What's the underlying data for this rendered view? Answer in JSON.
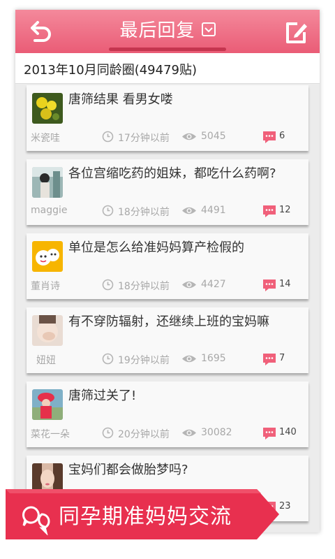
{
  "header": {
    "title": "最后回复",
    "back_icon": "back-arrow-icon",
    "dropdown_icon": "chevron-down-icon",
    "edit_icon": "compose-icon"
  },
  "subheader": {
    "text": "2013年10月同龄圈(49479贴)"
  },
  "posts": [
    {
      "title": "唐筛结果 看男女喽",
      "author": "米瓷哇",
      "time": "17分钟以前",
      "views": "5045",
      "comments": "6"
    },
    {
      "title": "各位宫缩吃药的姐妹，都吃什么药啊?",
      "author": "maggie",
      "time": "18分钟以前",
      "views": "4491",
      "comments": "12"
    },
    {
      "title": "单位是怎么给准妈妈算产检假的",
      "author": "董肖诗",
      "time": "18分钟以前",
      "views": "4427",
      "comments": "14"
    },
    {
      "title": "有不穿防辐射，还继续上班的宝妈嘛",
      "author": "妞妞",
      "time": "19分钟以前",
      "views": "1695",
      "comments": "7"
    },
    {
      "title": "唐筛过关了!",
      "author": "菜花一朵",
      "time": "20分钟以前",
      "views": "30082",
      "comments": "140"
    },
    {
      "title": "宝妈们都会做胎梦吗?",
      "author": "",
      "time": "",
      "views": "",
      "comments": "23"
    }
  ],
  "banner": {
    "text": "同孕期准妈妈交流",
    "icon": "chat-bubbles-icon"
  },
  "colors": {
    "accent": "#ea5c76",
    "banner": "#e8304f",
    "comment_badge": "#f0607a"
  }
}
